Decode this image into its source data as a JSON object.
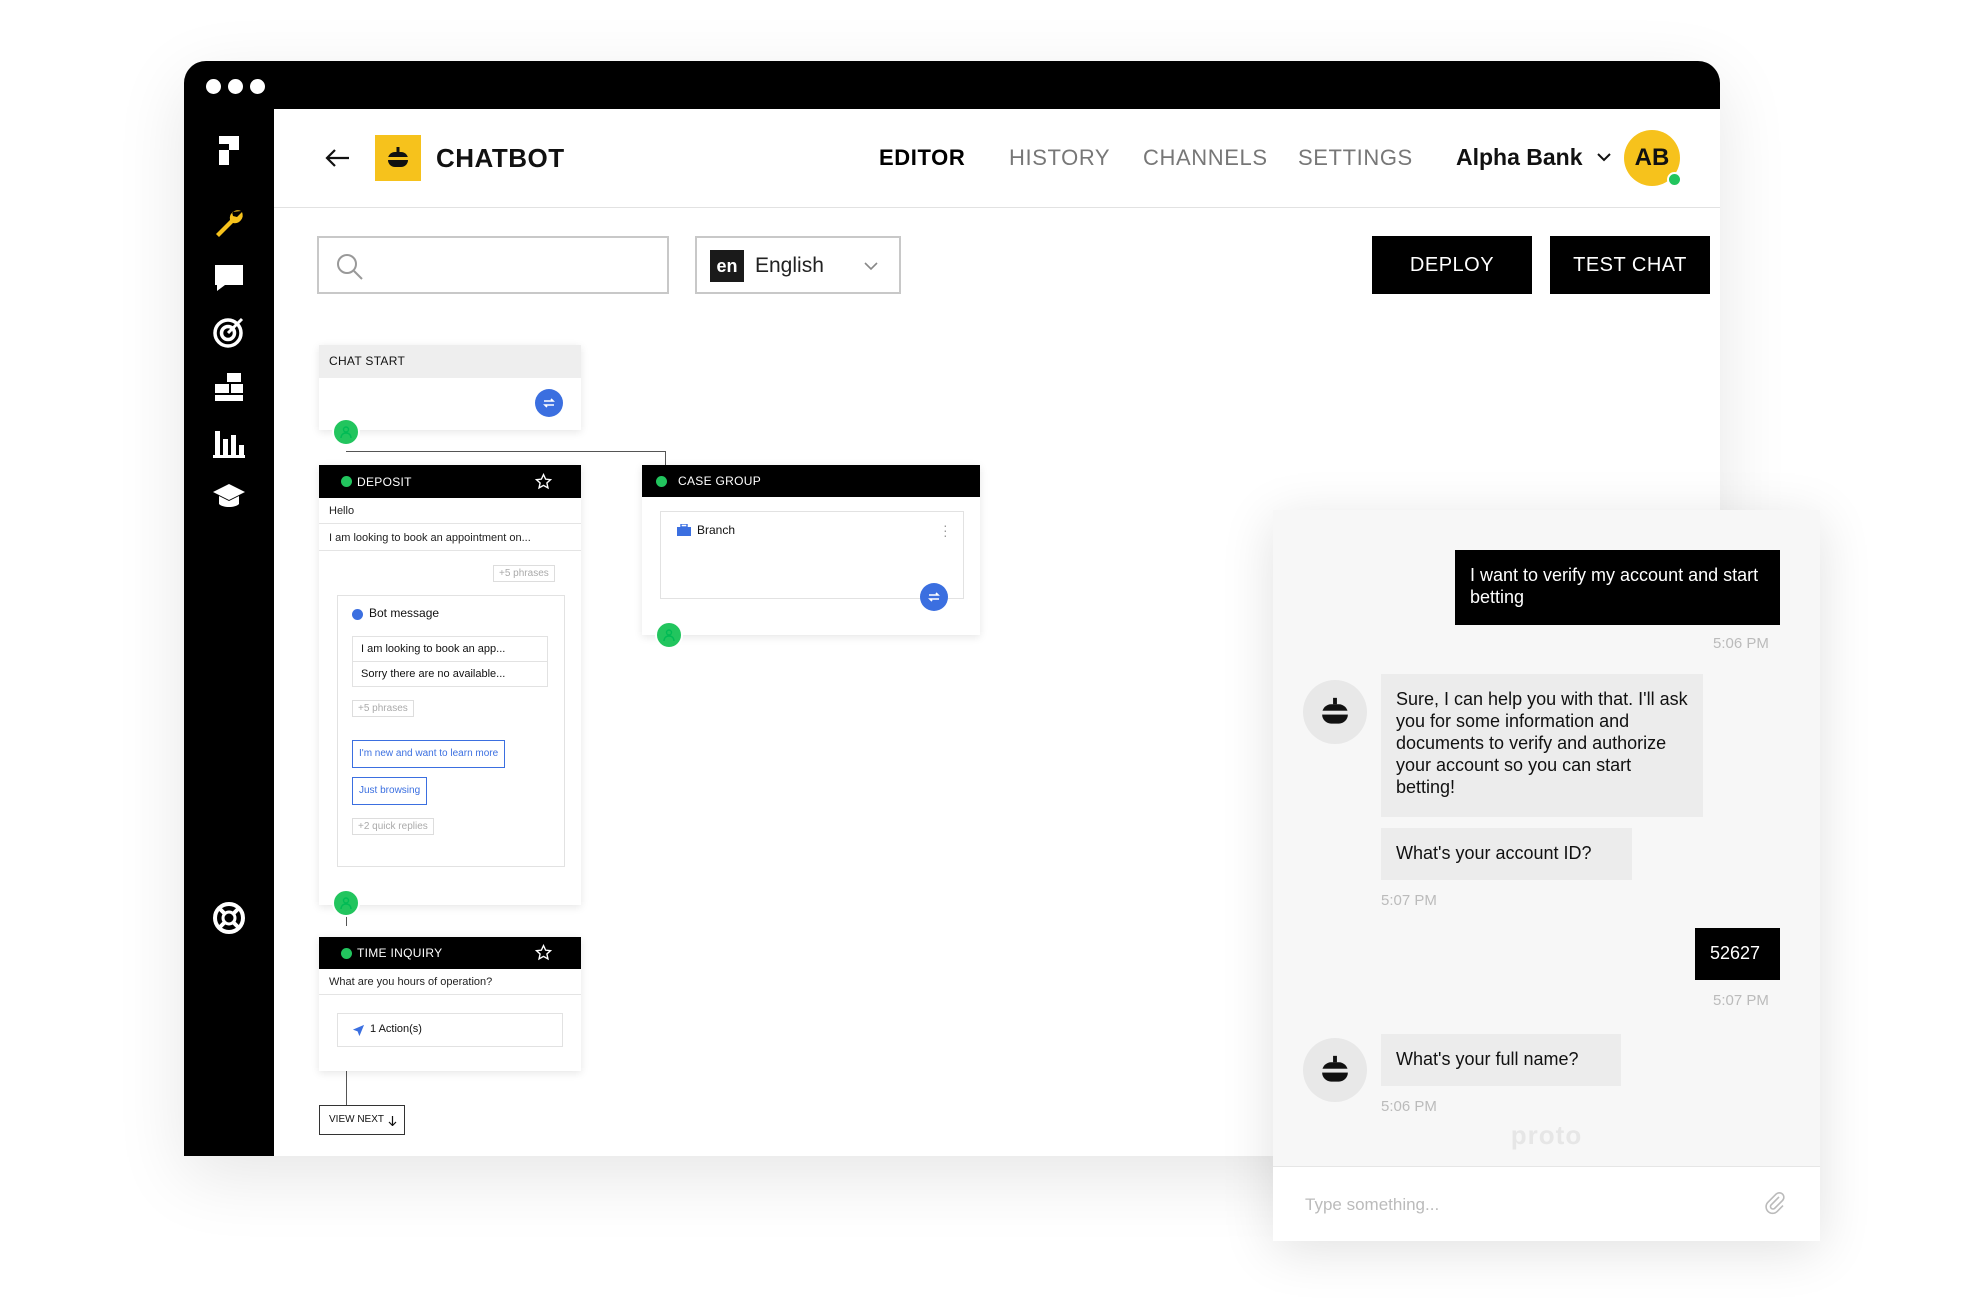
{
  "header": {
    "title": "CHATBOT",
    "nav": [
      "EDITOR",
      "HISTORY",
      "CHANNELS",
      "SETTINGS"
    ],
    "active_nav": "EDITOR",
    "org": "Alpha Bank",
    "avatar_initials": "AB"
  },
  "toolbar": {
    "search_placeholder": "",
    "language_code": "en",
    "language_name": "English",
    "deploy_label": "DEPLOY",
    "test_chat_label": "TEST CHAT"
  },
  "canvas": {
    "chat_start": {
      "title": "CHAT START"
    },
    "deposit": {
      "title": "DEPOSIT",
      "phrases": [
        "Hello",
        "I am looking to book an appointment on..."
      ],
      "more_phrases": "+5 phrases",
      "bot_message": {
        "title": "Bot message",
        "lines": [
          "I am looking to book an app...",
          "Sorry there are no available..."
        ],
        "more_phrases": "+5 phrases",
        "quick_replies": [
          "I'm new and want to learn more",
          "Just browsing"
        ],
        "more_quick_replies": "+2 quick replies"
      }
    },
    "case_group": {
      "title": "CASE GROUP",
      "item": "Branch"
    },
    "time_inquiry": {
      "title": "TIME INQUIRY",
      "phrase": "What are you hours of operation?",
      "actions": "1 Action(s)"
    },
    "view_next": "VIEW NEXT"
  },
  "chat": {
    "messages": [
      {
        "from": "user",
        "text": "I want to verify my account and start betting",
        "time": "5:06 PM"
      },
      {
        "from": "bot",
        "text": "Sure, I can help you with that. I'll ask you for some information and documents to verify and authorize your account so you can start betting!"
      },
      {
        "from": "bot",
        "text": "What's your account ID?",
        "time": "5:07 PM"
      },
      {
        "from": "user",
        "text": "52627",
        "time": "5:07 PM"
      },
      {
        "from": "bot",
        "text": "What's your full name?",
        "time": "5:06 PM"
      }
    ],
    "powered_by": "proto",
    "input_placeholder": "Type something..."
  },
  "colors": {
    "accent": "#f6c21c",
    "primary": "#000000",
    "link": "#3b6fe0",
    "online": "#22c55e"
  },
  "icons": {
    "sidebar": [
      "logo-icon",
      "wrench-icon",
      "chat-icon",
      "target-icon",
      "blocks-icon",
      "bar-chart-icon",
      "graduation-cap-icon",
      "help-lifebuoy-icon"
    ]
  }
}
